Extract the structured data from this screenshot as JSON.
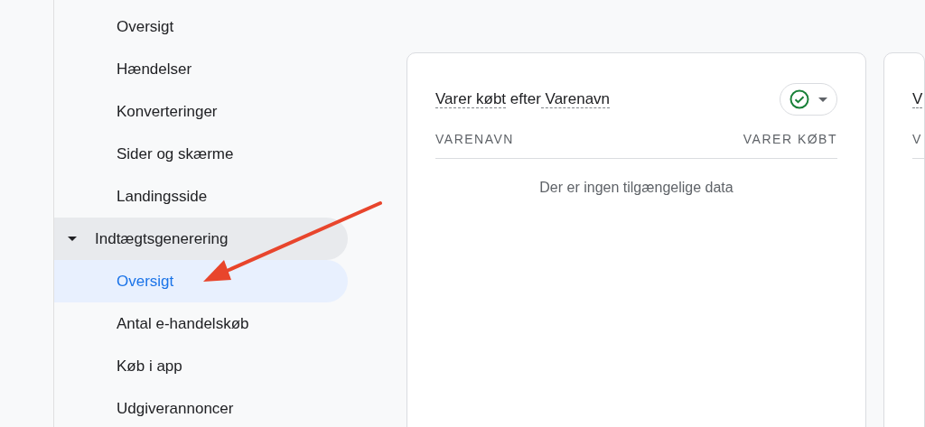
{
  "nav": {
    "items": [
      {
        "label": "Oversigt",
        "selected": false
      },
      {
        "label": "Hændelser",
        "selected": false
      },
      {
        "label": "Konverteringer",
        "selected": false
      },
      {
        "label": "Sider og skærme",
        "selected": false
      },
      {
        "label": "Landingsside",
        "selected": false
      }
    ],
    "group": {
      "label": "Indtægtsgenerering",
      "expanded": true,
      "children": [
        {
          "label": "Oversigt",
          "selected": true
        },
        {
          "label": "Antal e-handelskøb",
          "selected": false
        },
        {
          "label": "Køb i app",
          "selected": false
        },
        {
          "label": "Udgiverannoncer",
          "selected": false
        }
      ]
    }
  },
  "cards": [
    {
      "title_parts": [
        {
          "text": "Varer købt",
          "dashed": true
        },
        {
          "text": "efter",
          "dashed": false
        },
        {
          "text": "Varenavn",
          "dashed": true
        }
      ],
      "status_ok": true,
      "columns": [
        "VARENAVN",
        "VARER KØBT"
      ],
      "empty_message": "Der er ingen tilgængelige data"
    },
    {
      "title_parts": [
        {
          "text": "V",
          "dashed": true
        }
      ],
      "columns": [
        "V"
      ]
    }
  ]
}
